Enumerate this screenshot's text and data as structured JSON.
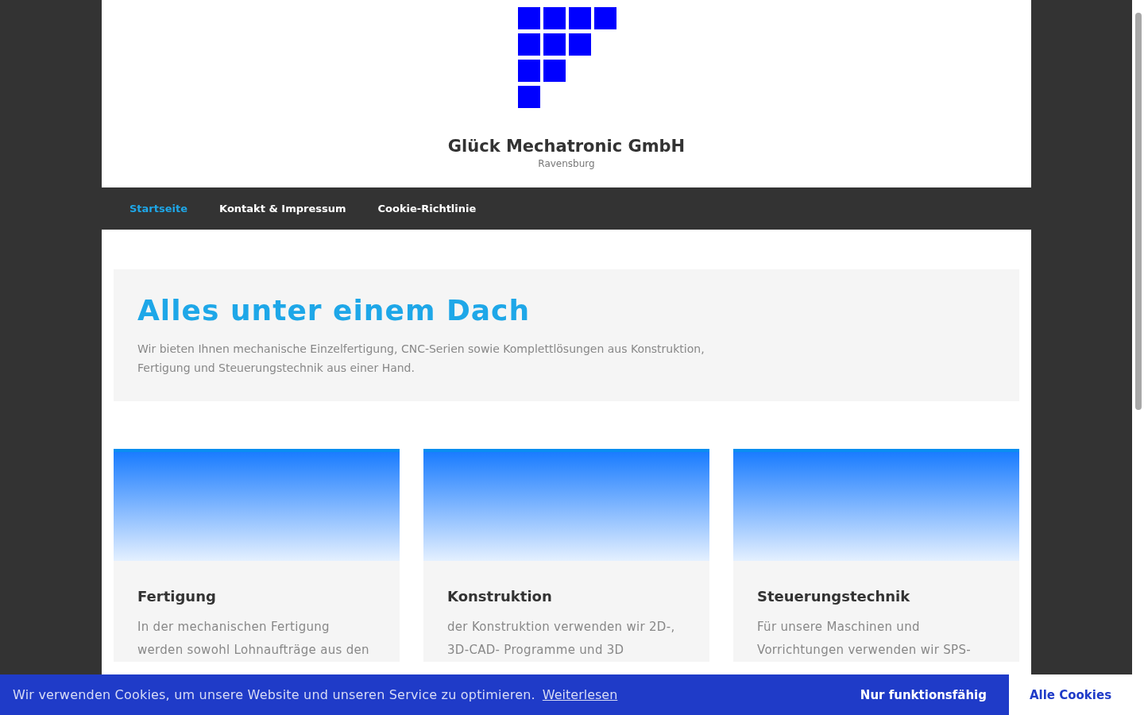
{
  "site": {
    "title": "Glück Mechatronic GmbH",
    "subtitle": "Ravensburg"
  },
  "nav": [
    {
      "label": "Startseite",
      "selected": true
    },
    {
      "label": "Kontakt & Impressum",
      "selected": false
    },
    {
      "label": "Cookie-Richtlinie",
      "selected": false
    }
  ],
  "hero": {
    "title": "Alles unter einem Dach",
    "text": "Wir bieten Ihnen mechanische Einzelfertigung, CNC-Serien sowie Komplettlösungen aus Konstruktion, Fertigung und Steuerungstechnik aus einer Hand."
  },
  "cards": [
    {
      "title": "Fertigung",
      "text": "In der mechanischen Fertigung werden sowohl Lohnaufträge aus den"
    },
    {
      "title": "Konstruktion",
      "text": "der Konstruktion verwenden wir 2D-, 3D-CAD- Programme und 3D"
    },
    {
      "title": "Steuerungstechnik",
      "text": "Für unsere Maschinen und Vorrichtungen verwenden wir SPS-"
    }
  ],
  "cookie_bar": {
    "text": "Wir verwenden Cookies, um unsere Website und unseren Service zu optimieren.",
    "link": "Weiterlesen",
    "buttons": [
      "Nur funktionsfähig",
      "Alle Cookies"
    ]
  }
}
